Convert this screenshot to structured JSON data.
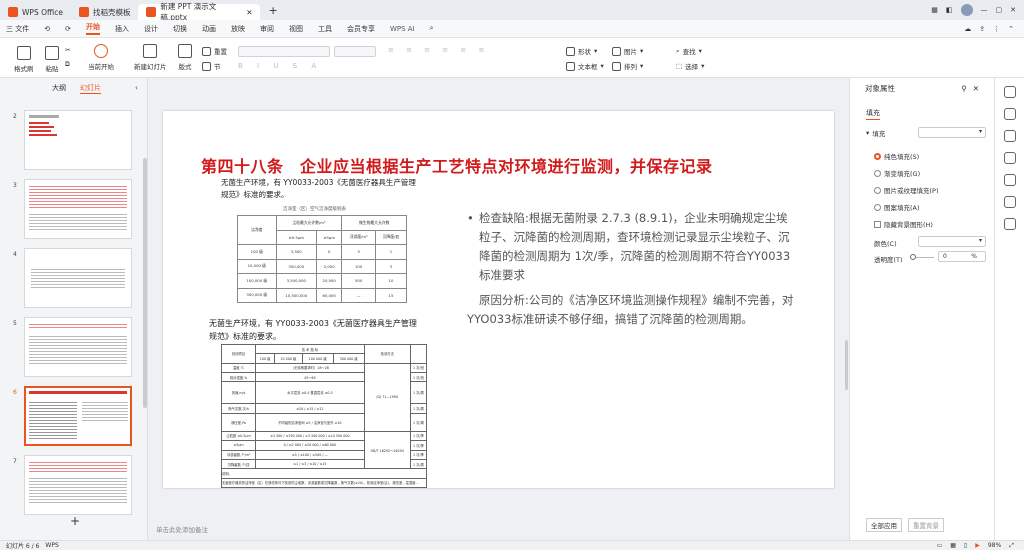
{
  "tabs": [
    {
      "label": "WPS Office",
      "color": "#e9541f"
    },
    {
      "label": "找稻壳模板",
      "color": "#e9541f"
    },
    {
      "label": "新建 PPT 演示文稿.pptx",
      "color": "#e9541f"
    }
  ],
  "title_bar": {
    "new_tab": "+",
    "login": "立即登录"
  },
  "menu": {
    "file": "三 文件",
    "items": [
      "开始",
      "插入",
      "设计",
      "切换",
      "动画",
      "放映",
      "审阅",
      "视图",
      "工具",
      "会员专享"
    ],
    "ai": "WPS AI"
  },
  "ribbon": {
    "format_painter": "格式刷",
    "paste": "粘贴",
    "play_from_current": "当前开始",
    "new_slide": "新建幻灯片",
    "layout": "版式",
    "section": "节",
    "reset": "重置",
    "shape": "形状",
    "picture": "图片",
    "textbox": "文本框",
    "arrange": "排列",
    "find": "查找",
    "select": "选择"
  },
  "left_panel": {
    "tab_outline": "大纲",
    "tab_slides": "幻灯片",
    "slide_numbers": [
      "2",
      "3",
      "4",
      "5",
      "6",
      "7"
    ],
    "add_label": "+"
  },
  "slide": {
    "title": "第四十八条　企业应当根据生产工艺特点对环境进行监测，并保存记录",
    "top_text_1": "无菌生产环境，有 YY0033-2003《无菌医疗器具生产管理",
    "top_text_2": "规范》标准的要求。",
    "table1_caption": "洁净室（区）空气洁净度级别表",
    "table1_headers": [
      "洁净度",
      "尘粒最大允许数/m³",
      "",
      "微生物最大允许数",
      ""
    ],
    "table1_subheaders": [
      "",
      "≥0.5μm",
      "≥5μm",
      "浮游菌/m³",
      "沉降菌/皿"
    ],
    "table1_rows": [
      [
        "100 级",
        "3,500",
        "0",
        "5",
        "1"
      ],
      [
        "10,000 级",
        "350,000",
        "2,000",
        "100",
        "3"
      ],
      [
        "100,000 级",
        "3,500,000",
        "20,000",
        "500",
        "10"
      ],
      [
        "300,000 级",
        "10,500,000",
        "60,000",
        "—",
        "15"
      ]
    ],
    "mid_text_1": "无菌生产环境，有 YY0033-2003《无菌医疗器具生产管理",
    "mid_text_2": "规范》标准的要求。",
    "bullet_text": "检查缺陷:根据无菌附录 2.7.3 (8.9.1)，企业未明确规定尘埃粒子、沉降菌的检测周期，查环境检测记录显示尘埃粒子、沉降菌的检测周期为 1次/季，沉降菌的检测周期不符合YY0033标准要求",
    "para2": "原因分析:公司的《洁净区环境监测操作规程》编制不完善，对YYO033标准研读不够仔细，搞错了沉降菌的检测周期。",
    "table2_top_headers": [
      "检测项目",
      "技 术 指 标",
      "检测方法"
    ],
    "table2_levels": [
      "100 级",
      "10 000 级",
      "100 000 级",
      "300 000 级"
    ],
    "table2_rows": [
      [
        "温度,℃",
        "（无特殊要求时）18～28",
        "1 次/班"
      ],
      [
        "相对湿度,%",
        "45～65",
        "1 次/班"
      ],
      [
        "风速,m/s",
        "水平层流 ≥0.4 垂直层流 ≥0.3",
        "1 次/周"
      ],
      [
        "换气次数,次/h",
        "≥20 / ≥15 / ≥12",
        "1 次/周"
      ],
      [
        "静压差,Pa",
        "不同级别洁净室间 ≥5 / 洁净室与室外 ≥10",
        "1 次/周"
      ],
      [
        "尘粒数 ≥0.5μm",
        "≤3 500 / ≤350 000 / ≤3 500 000 / ≤10 500 000",
        "1 次/季"
      ],
      [
        "≥5μm",
        "0 / ≤2 000 / ≤20 000 / ≤60 000",
        "1 次/季"
      ],
      [
        "浮游菌数,个/m³",
        "≤5 / ≤100 / ≤500 / —",
        "1 次/季"
      ],
      [
        "沉降菌数,个/皿",
        "≤1 / ≤3 / ≤10 / ≤15",
        "1 次/周"
      ]
    ],
    "table2_method_top": "JGJ 71—1990",
    "table2_method_bottom": "GB/T 16292～16294",
    "table2_note_1": "说明。",
    "table2_note_2": "无菌医疗器具的洁净室（区）在静态条件下检测的尘埃数，浮游菌数或沉降菌数，换气次数(≥20)，检测洁净室(区)，静压差，温湿度…"
  },
  "notes_placeholder": "单击此处添加备注",
  "right_panel": {
    "title": "对象属性",
    "tab_fill": "填充",
    "section_fill": "填充",
    "options": [
      "纯色填充(S)",
      "渐变填充(G)",
      "图片或纹理填充(P)",
      "图案填充(A)"
    ],
    "hide_bg": "隐藏背景图形(H)",
    "color_label": "颜色(C)",
    "transparency_label": "透明度(T)",
    "transparency_value": "0",
    "transparency_unit": "%",
    "apply_all": "全部应用",
    "reset_bg": "重置背景"
  },
  "status_bar": {
    "slide_info": "幻灯片 6 / 6",
    "app": "WPS",
    "zoom": "98%"
  },
  "colors": {
    "accent": "#e9541f",
    "title_red": "#d21a1a"
  }
}
